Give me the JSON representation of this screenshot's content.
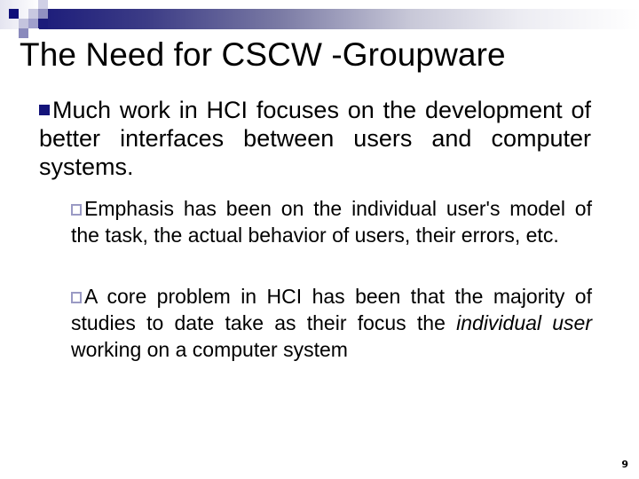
{
  "slide": {
    "title": "The Need for CSCW -Groupware",
    "page_number": "9",
    "colors": {
      "accent_navy": "#14147a",
      "hollow_bullet": "#9a9ac4",
      "text": "#000000",
      "background": "#ffffff"
    },
    "bullets": [
      {
        "level": 1,
        "icon": "filled-square-bullet",
        "text": "Much work in HCI focuses on the development of better interfaces between users and computer systems.",
        "children": [
          {
            "level": 2,
            "icon": "hollow-square-bullet",
            "text": "Emphasis has been on the individual user's model of the task, the actual behavior of users, their errors, etc."
          },
          {
            "level": 2,
            "icon": "hollow-square-bullet",
            "text_before": "A core problem in HCI has been that the majority of studies to date take as their focus the ",
            "text_italic": "individual user",
            "text_after": " working on a computer system"
          }
        ]
      }
    ]
  }
}
